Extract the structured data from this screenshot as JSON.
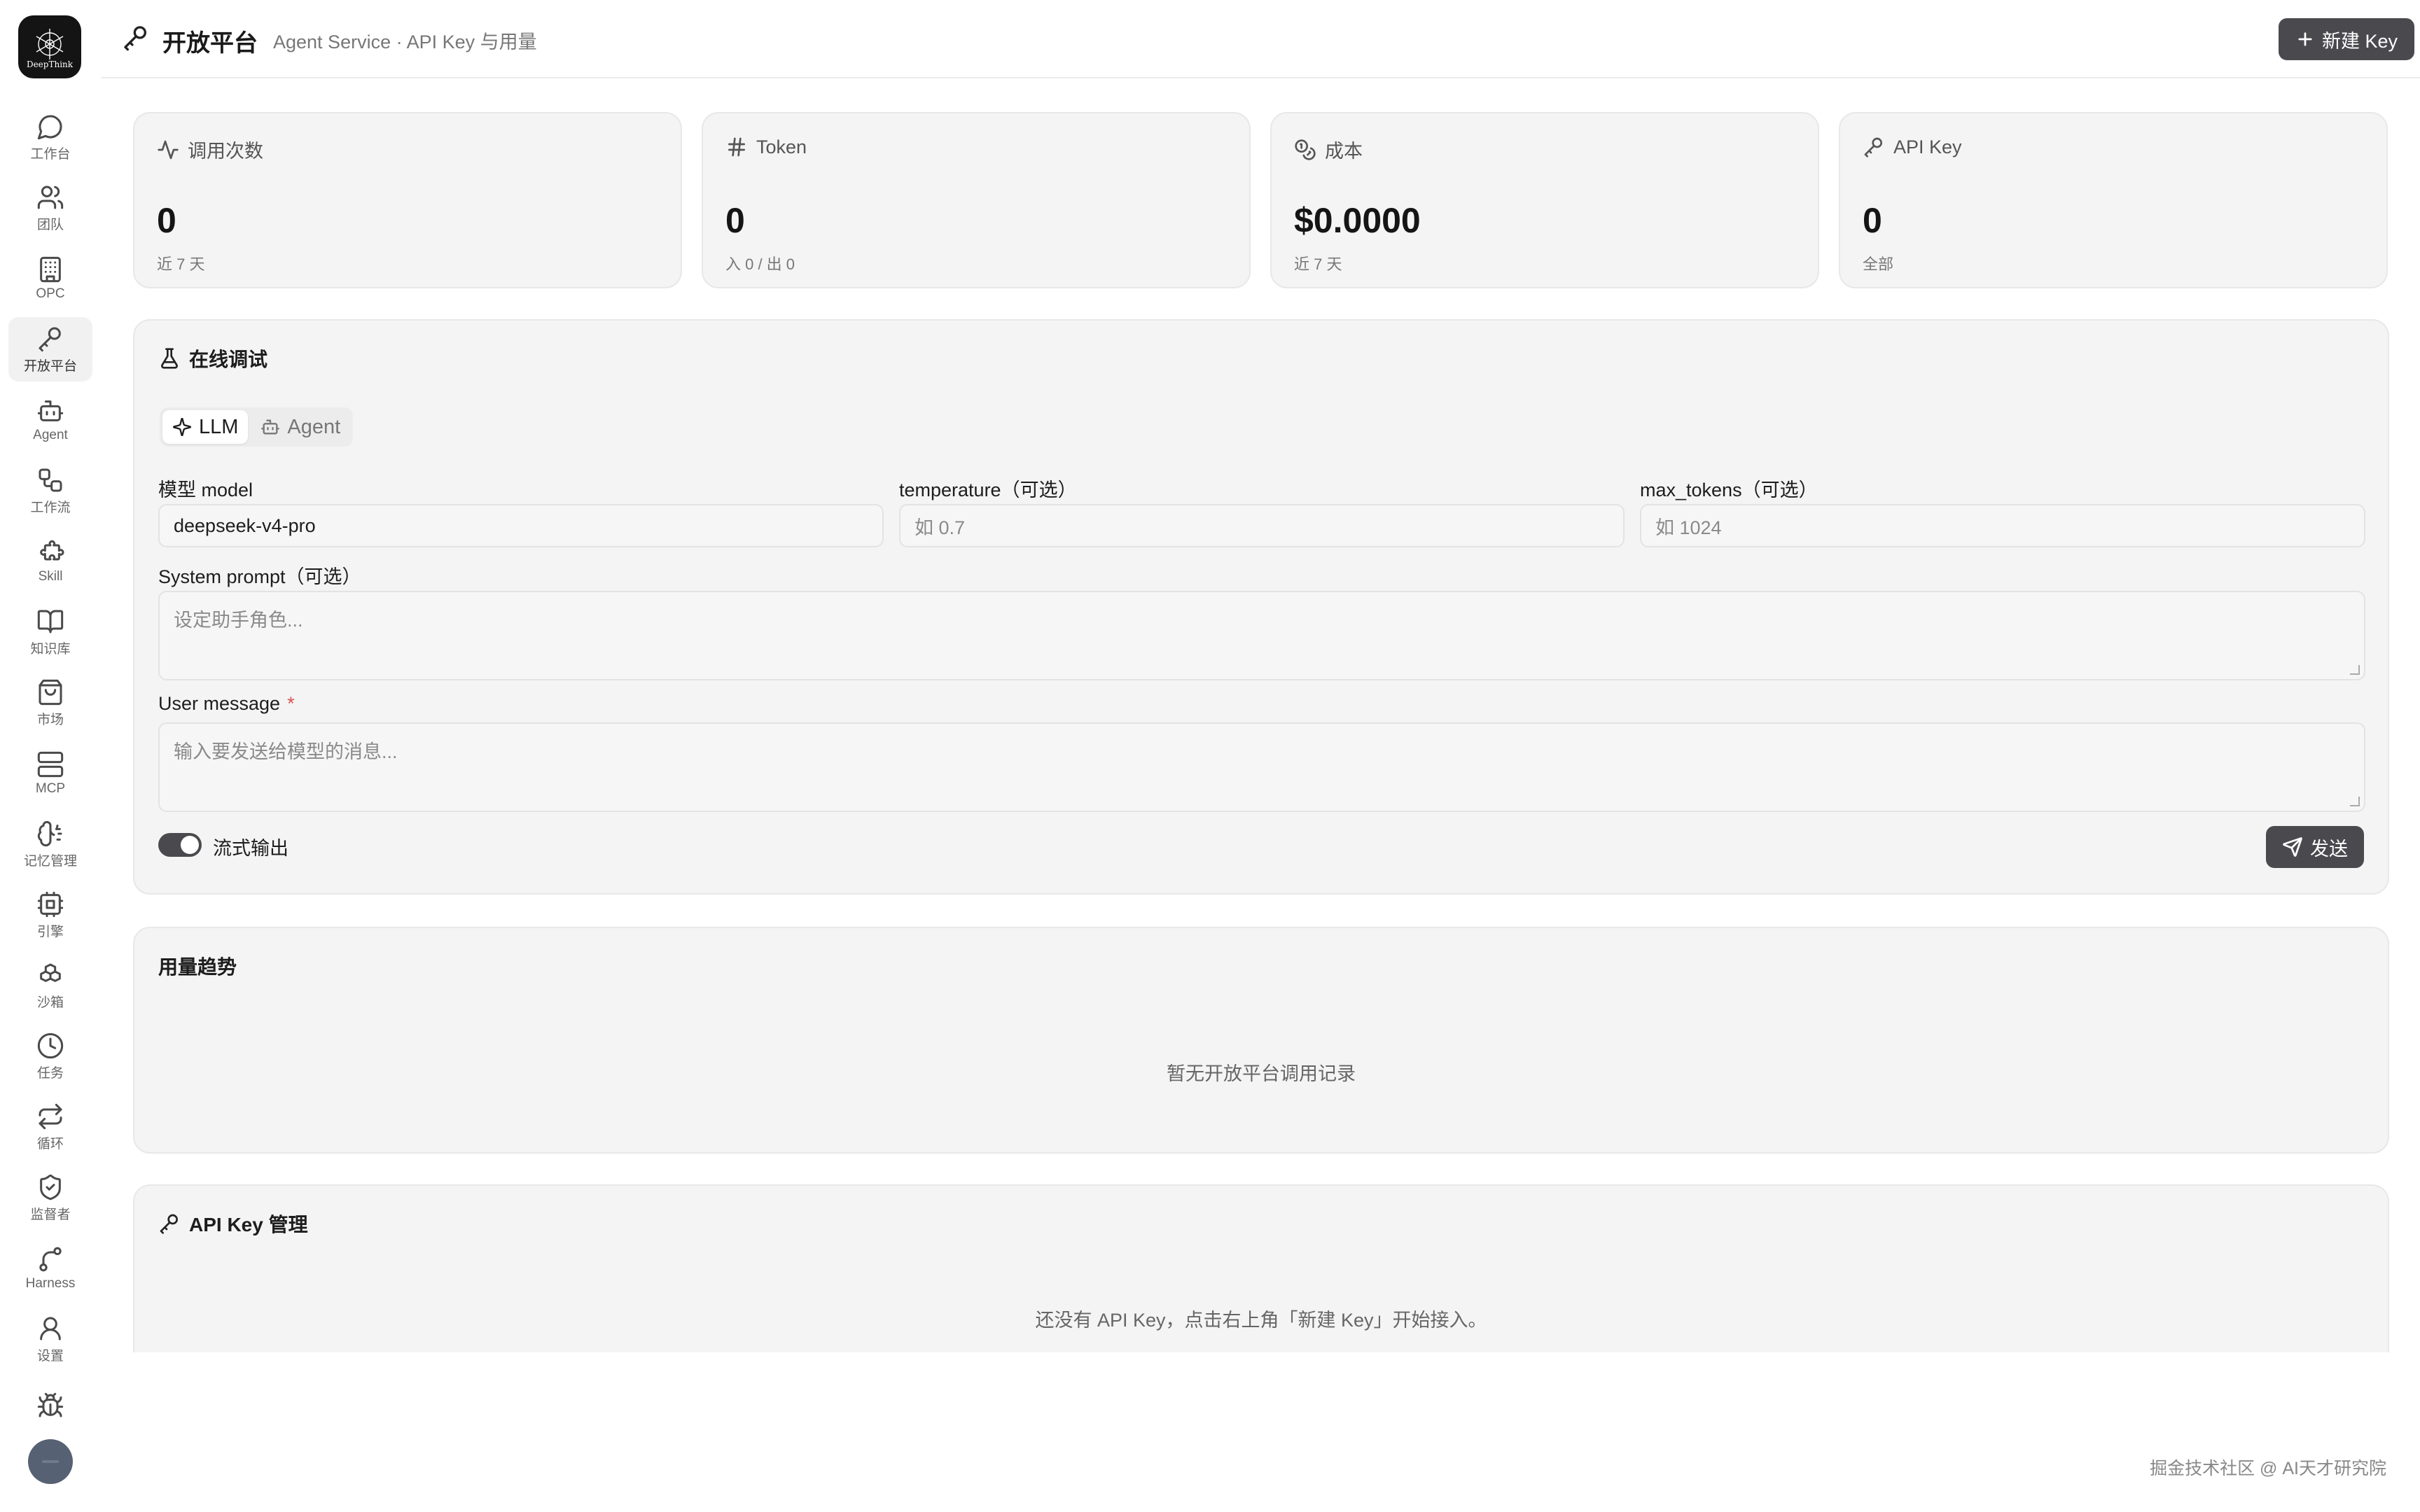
{
  "sidebar": {
    "logo_text": "DeepThink",
    "items": [
      {
        "label": "工作台",
        "icon": "chat-icon"
      },
      {
        "label": "团队",
        "icon": "users-icon"
      },
      {
        "label": "OPC",
        "icon": "building-icon"
      },
      {
        "label": "开放平台",
        "icon": "key-icon"
      },
      {
        "label": "Agent",
        "icon": "bot-icon"
      },
      {
        "label": "工作流",
        "icon": "workflow-icon"
      },
      {
        "label": "Skill",
        "icon": "puzzle-icon"
      },
      {
        "label": "知识库",
        "icon": "book-icon"
      },
      {
        "label": "市场",
        "icon": "shopping-bag-icon"
      },
      {
        "label": "MCP",
        "icon": "server-icon"
      },
      {
        "label": "记忆管理",
        "icon": "brain-icon"
      },
      {
        "label": "引擎",
        "icon": "cpu-icon"
      },
      {
        "label": "沙箱",
        "icon": "boxes-icon"
      },
      {
        "label": "任务",
        "icon": "clock-icon"
      },
      {
        "label": "循环",
        "icon": "repeat-icon"
      },
      {
        "label": "监督者",
        "icon": "shield-icon"
      },
      {
        "label": "Harness",
        "icon": "git-branch-icon"
      },
      {
        "label": "设置",
        "icon": "user-icon"
      }
    ],
    "active_index": 3
  },
  "header": {
    "title": "开放平台",
    "subtitle": "Agent Service · API Key 与用量",
    "new_key_label": "新建 Key"
  },
  "stats": [
    {
      "label": "调用次数",
      "value": "0",
      "sub": "近 7 天",
      "icon": "activity-icon"
    },
    {
      "label": "Token",
      "value": "0",
      "sub": "入 0 / 出 0",
      "icon": "hash-icon"
    },
    {
      "label": "成本",
      "value": "$0.0000",
      "sub": "近 7 天",
      "icon": "coins-icon"
    },
    {
      "label": "API Key",
      "value": "0",
      "sub": "全部",
      "icon": "key-icon"
    }
  ],
  "debug": {
    "title": "在线调试",
    "tabs": [
      {
        "label": "LLM",
        "active": true
      },
      {
        "label": "Agent",
        "active": false
      }
    ],
    "model_label": "模型 model",
    "model_value": "deepseek-v4-pro",
    "temperature_label": "temperature（可选）",
    "temperature_placeholder": "如 0.7",
    "max_tokens_label": "max_tokens（可选）",
    "max_tokens_placeholder": "如 1024",
    "system_prompt_label": "System prompt（可选）",
    "system_prompt_placeholder": "设定助手角色...",
    "user_message_label": "User message",
    "required_mark": "*",
    "user_message_placeholder": "输入要发送给模型的消息...",
    "stream_label": "流式输出",
    "stream_on": true,
    "send_label": "发送"
  },
  "usage": {
    "title": "用量趋势",
    "empty_text": "暂无开放平台调用记录"
  },
  "api_keys": {
    "title": "API Key 管理",
    "empty_text": "还没有 API Key，点击右上角「新建 Key」开始接入。"
  },
  "footer_note": "掘金技术社区 @ AI天才研究院"
}
